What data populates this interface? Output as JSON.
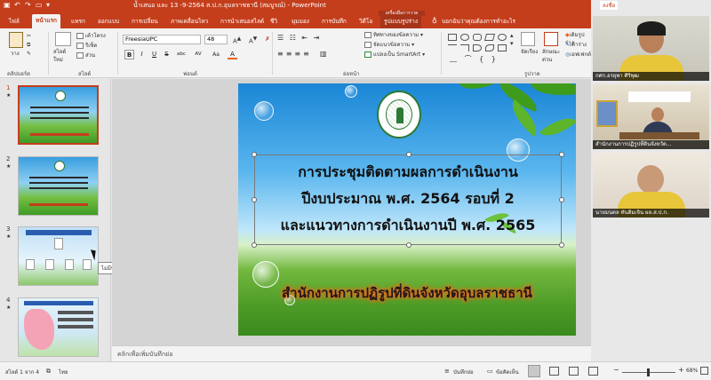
{
  "window": {
    "title": "น้ำเสนอ และ 13 -9-2564 ส.ป.ก.อุบลราชธานี (สมบูรณ์) - PowerPoint",
    "corner_label": "ลงชื่อ"
  },
  "ribbon_tabs": [
    "ไฟล์",
    "หน้าแรก",
    "แทรก",
    "ออกแบบ",
    "การเปลี่ยน",
    "ภาพเคลื่อนไหว",
    "การนำเสนอสไลด์",
    "ชีวิ",
    "มุมมอง",
    "การบันทึก",
    "วิดีโอ",
    "รูปแบบรูปร่าง"
  ],
  "contextual_tab_header": "เครื่องมือการวาด",
  "tell_me": "บอกฉันว่าคุณต้องการทำอะไร",
  "ribbon": {
    "clipboard": {
      "label": "คลิปบอร์ด",
      "paste": "วาง"
    },
    "slides": {
      "label": "สไลด์",
      "new_slide": "สไลด์ใหม่",
      "layout": "เค้าโครง",
      "reset": "รีเซ็ต",
      "section": "ส่วน"
    },
    "font": {
      "label": "ฟอนต์",
      "name": "FreesiaUPC",
      "size": "48",
      "bold": "B",
      "italic": "I",
      "underline": "U",
      "strike": "S",
      "shadow": "abc",
      "spacing": "AV",
      "case": "Aa",
      "color": "A"
    },
    "paragraph": {
      "label": "ย่อหน้า",
      "text_direction": "ทิศทางของข้อความ",
      "align_text": "จัดแนวข้อความ",
      "smartart": "แปลงเป็น SmartArt"
    },
    "drawing": {
      "label": "รูปวาด",
      "arrange": "จัดเรียง",
      "quick_styles": "ลักษณะ ด่วน",
      "fill": "เติมรูปร่าง",
      "outline": "เค้าร่าง",
      "effects": "เอฟเฟกต์"
    }
  },
  "thumbnails": [
    {
      "number": "1",
      "star": "★",
      "selected": true
    },
    {
      "number": "2",
      "star": "★",
      "selected": false
    },
    {
      "number": "3",
      "star": "★",
      "selected": false
    },
    {
      "number": "4",
      "star": "★",
      "selected": false
    }
  ],
  "tooltip": "ไม่มีชื่อเรื่อง",
  "slide": {
    "title_lines": [
      "การประชุมติดตามผลการดำเนินงาน",
      "ปีงบประมาณ พ.ศ. 2564 รอบที่ 2",
      "และแนวทางการดำเนินงานปี พ.ศ. 2565"
    ],
    "subtitle": "สำนักงานการปฏิรูปที่ดินจังหวัดอุบลราชธานี"
  },
  "notes_placeholder": "คลิกเพื่อเพิ่มบันทึกย่อ",
  "status": {
    "slide_counter": "สไลด์ 1 จาก 4",
    "language": "ไทย",
    "notes_button": "บันทึกย่อ",
    "comments_button": "ข้อคิดเห็น",
    "zoom": "68%",
    "minus": "−",
    "plus": "+"
  },
  "video_tiles": [
    {
      "name": "กศก.อรยุพา ศิริพุฒ"
    },
    {
      "name": "สำนักงานการปฏิรูปที่ดินจังหวัด..."
    },
    {
      "name": "นายมนตล ทันติมเจิน ผล.ส.ป.ก."
    }
  ],
  "colors": {
    "accent": "#c43e1c",
    "canvas": "#d4d4d4"
  }
}
